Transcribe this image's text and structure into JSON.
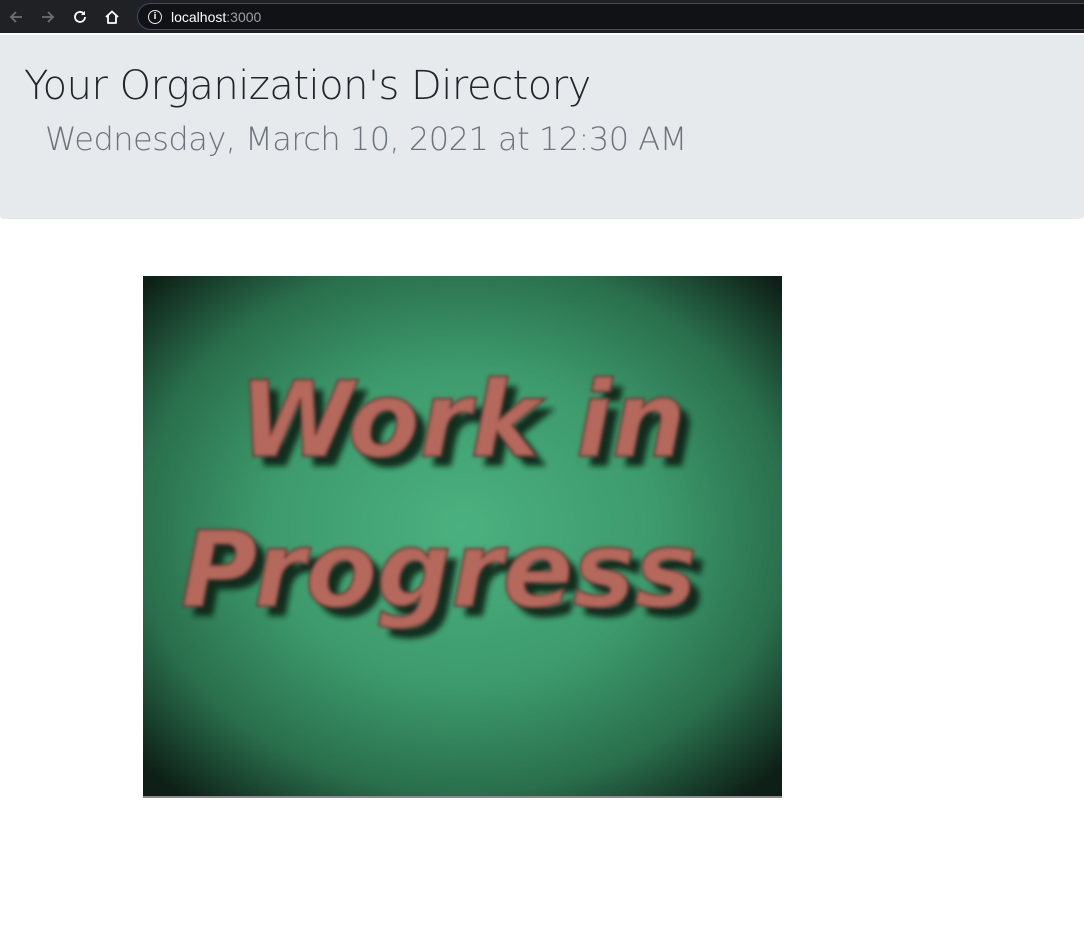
{
  "browser": {
    "url_host": "localhost",
    "url_port": ":3000",
    "icons": [
      "back-arrow-icon",
      "forward-arrow-icon",
      "reload-icon",
      "home-icon",
      "info-icon"
    ]
  },
  "header": {
    "title": "Your Organization's Directory",
    "subtitle": "Wednesday, March 10, 2021 at 12:30 AM"
  },
  "main": {
    "image": {
      "line1": "Work in",
      "line2": "Progress"
    }
  },
  "colors": {
    "jumbotron_bg": "#e7eaed",
    "image_green": "#3f9a6e",
    "image_text": "#b5675b"
  }
}
